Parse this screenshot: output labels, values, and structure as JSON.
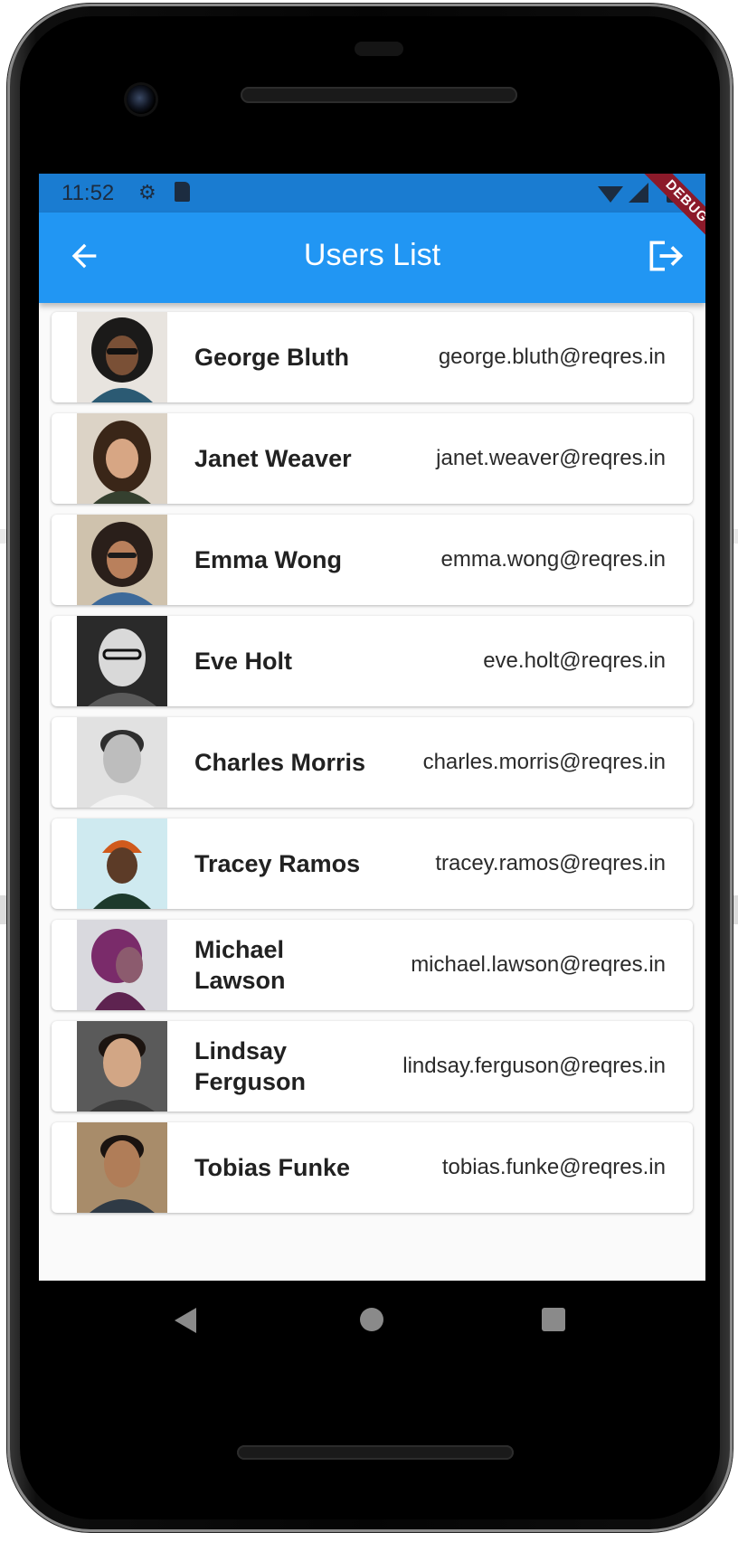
{
  "status_bar": {
    "time": "11:52",
    "icons": [
      "gear-icon",
      "sd-card-icon",
      "wifi-icon",
      "signal-icon",
      "battery-icon"
    ]
  },
  "debug_banner": "DEBUG",
  "app_bar": {
    "title": "Users List",
    "back_icon": "arrow-back-icon",
    "logout_icon": "logout-icon",
    "color": "#2196f3"
  },
  "users": [
    {
      "name": "George Bluth",
      "email": "george.bluth@reqres.in"
    },
    {
      "name": "Janet Weaver",
      "email": "janet.weaver@reqres.in"
    },
    {
      "name": "Emma Wong",
      "email": "emma.wong@reqres.in"
    },
    {
      "name": "Eve Holt",
      "email": "eve.holt@reqres.in"
    },
    {
      "name": "Charles Morris",
      "email": "charles.morris@reqres.in"
    },
    {
      "name": "Tracey Ramos",
      "email": "tracey.ramos@reqres.in"
    },
    {
      "name": "Michael Lawson",
      "email": "michael.lawson@reqres.in"
    },
    {
      "name": "Lindsay Ferguson",
      "email": "lindsay.ferguson@reqres.in"
    },
    {
      "name": "Tobias Funke",
      "email": "tobias.funke@reqres.in"
    }
  ],
  "nav_bar": {
    "icons": [
      "nav-back-icon",
      "nav-home-icon",
      "nav-recent-apps-icon"
    ]
  }
}
